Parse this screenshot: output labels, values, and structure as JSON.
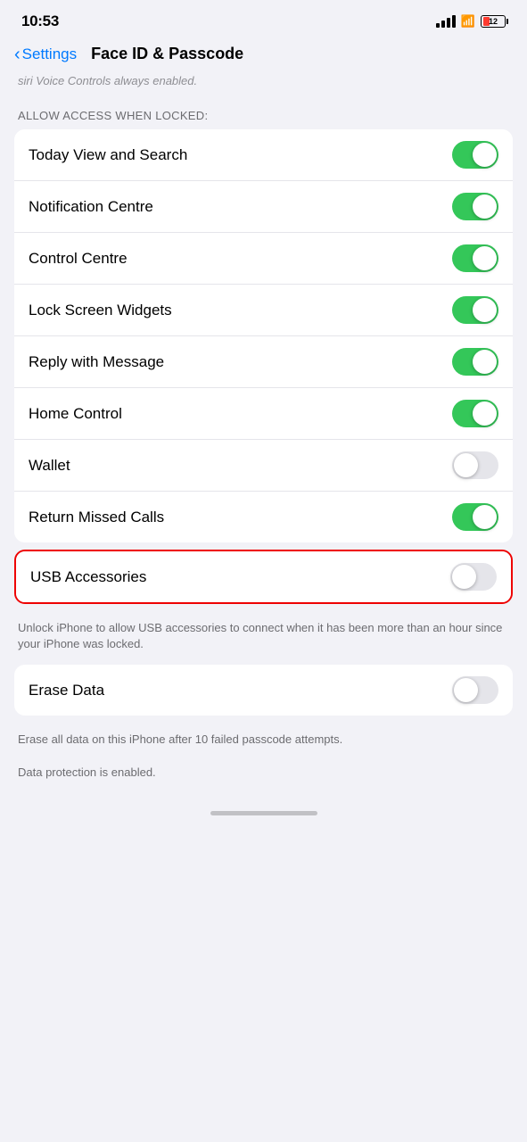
{
  "status": {
    "time": "10:53",
    "battery_num": "12"
  },
  "nav": {
    "back_label": "Settings",
    "title": "Face ID & Passcode"
  },
  "hint": "siri Voice Controls always enabled.",
  "section_label": "ALLOW ACCESS WHEN LOCKED:",
  "rows": [
    {
      "id": "today-view",
      "label": "Today View and Search",
      "state": "on"
    },
    {
      "id": "notification-centre",
      "label": "Notification Centre",
      "state": "on"
    },
    {
      "id": "control-centre",
      "label": "Control Centre",
      "state": "on"
    },
    {
      "id": "lock-screen-widgets",
      "label": "Lock Screen Widgets",
      "state": "on"
    },
    {
      "id": "reply-with-message",
      "label": "Reply with Message",
      "state": "on"
    },
    {
      "id": "home-control",
      "label": "Home Control",
      "state": "on"
    },
    {
      "id": "wallet",
      "label": "Wallet",
      "state": "off"
    },
    {
      "id": "return-missed-calls",
      "label": "Return Missed Calls",
      "state": "on"
    }
  ],
  "usb_row": {
    "label": "USB Accessories",
    "state": "off"
  },
  "usb_desc": "Unlock iPhone to allow USB accessories to connect when it has been more than an hour since your iPhone was locked.",
  "erase_row": {
    "label": "Erase Data",
    "state": "off"
  },
  "erase_desc": "Erase all data on this iPhone after 10 failed passcode attempts.",
  "data_protection": "Data protection is enabled."
}
